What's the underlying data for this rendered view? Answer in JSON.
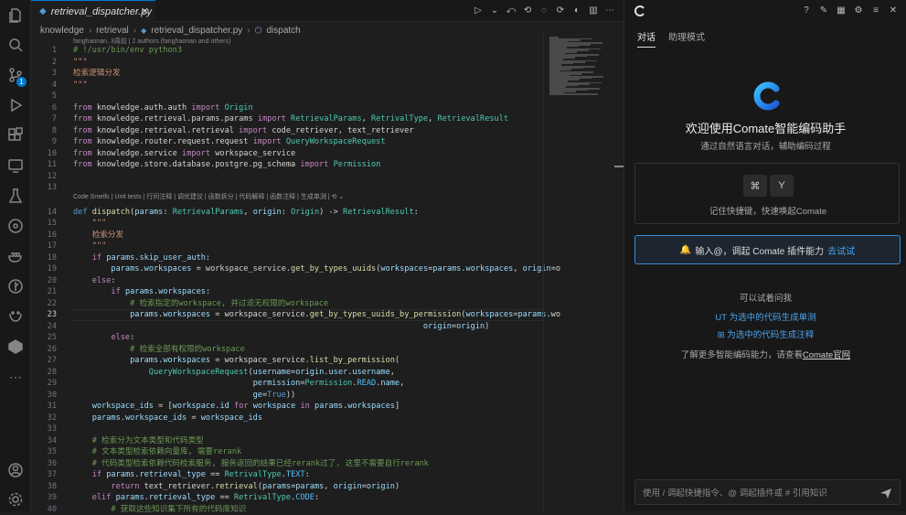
{
  "editor": {
    "tab_label": "retrieval_dispatcher.py",
    "breadcrumb": [
      "knowledge",
      "retrieval",
      "retrieval_dispatcher.py",
      "dispatch"
    ],
    "blame": "fanghaonan, 3周前 | 2 authors (fanghaonan and others)",
    "codelens": "Code Smells | Unit tests | 行间注释 | 调优建议 | 函数拆分 | 代码解释 | 函数注释 | 生成单测 |",
    "current_line": 23,
    "source_control_badge": "1"
  },
  "code_lines": [
    {
      "n": "1",
      "html": "<span class='c'># !/usr/bin/env python3</span>"
    },
    {
      "n": "2",
      "html": "<span class='s'>\"\"\"</span>"
    },
    {
      "n": "3",
      "html": "<span class='s'>检索逻辑分发</span>"
    },
    {
      "n": "4",
      "html": "<span class='s'>\"\"\"</span>"
    },
    {
      "n": "5",
      "html": ""
    },
    {
      "n": "6",
      "html": "<span class='k'>from</span> knowledge.auth.auth <span class='k'>import</span> <span class='t'>Origin</span>"
    },
    {
      "n": "7",
      "html": "<span class='k'>from</span> knowledge.retrieval.params.params <span class='k'>import</span> <span class='t'>RetrievalParams</span>, <span class='t'>RetrivalType</span>, <span class='t'>RetrievalResult</span>"
    },
    {
      "n": "8",
      "html": "<span class='k'>from</span> knowledge.retrieval.retrieval <span class='k'>import</span> code_retriever, text_retriever"
    },
    {
      "n": "9",
      "html": "<span class='k'>from</span> knowledge.router.request.request <span class='k'>import</span> <span class='t'>QueryWorkspaceRequest</span>"
    },
    {
      "n": "10",
      "html": "<span class='k'>from</span> knowledge.service <span class='k'>import</span> workspace_service"
    },
    {
      "n": "11",
      "html": "<span class='k'>from</span> knowledge.store.database.postgre.pg_schema <span class='k'>import</span> <span class='t'>Permission</span>"
    },
    {
      "n": "12",
      "html": ""
    },
    {
      "n": "13",
      "html": ""
    },
    {
      "n": "14",
      "html": "<span class='p'>def</span> <span class='f'>dispatch</span>(<span class='v'>params</span>: <span class='t'>RetrievalParams</span>, <span class='v'>origin</span>: <span class='t'>Origin</span>) -> <span class='t'>RetrievalResult</span>:"
    },
    {
      "n": "15",
      "html": "    <span class='s'>\"\"\"</span>"
    },
    {
      "n": "16",
      "html": "    <span class='s'>检索分发</span>"
    },
    {
      "n": "17",
      "html": "    <span class='s'>\"\"\"</span>"
    },
    {
      "n": "18",
      "html": "    <span class='k'>if</span> <span class='v'>params</span>.<span class='v'>skip_user_auth</span>:"
    },
    {
      "n": "19",
      "html": "        <span class='v'>params</span>.<span class='v'>workspaces</span> = workspace_service.<span class='f'>get_by_types_uuids</span>(<span class='v'>workspaces</span>=<span class='v'>params</span>.<span class='v'>workspaces</span>, <span class='v'>origin</span>=o"
    },
    {
      "n": "20",
      "html": "    <span class='k'>else</span>:"
    },
    {
      "n": "21",
      "html": "        <span class='k'>if</span> <span class='v'>params</span>.<span class='v'>workspaces</span>:"
    },
    {
      "n": "22",
      "html": "            <span class='c'># 检索指定的workspace, 并过滤无权限的workspace</span>"
    },
    {
      "n": "23",
      "html": "            <span class='v'>params</span>.<span class='v'>workspaces</span> = workspace_service.<span class='f'>get_by_types_uuids_by_permission</span>(<span class='v'>workspaces</span>=<span class='v'>params</span>.wo"
    },
    {
      "n": "24",
      "html": "                                                                          <span class='v'>origin</span>=<span class='v'>origin</span>)"
    },
    {
      "n": "25",
      "html": "        <span class='k'>else</span>:"
    },
    {
      "n": "26",
      "html": "            <span class='c'># 检索全部有权限的workspace</span>"
    },
    {
      "n": "27",
      "html": "            <span class='v'>params</span>.<span class='v'>workspaces</span> = workspace_service.<span class='f'>list_by_permission</span>("
    },
    {
      "n": "28",
      "html": "                <span class='t'>QueryWorkspaceRequest</span>(<span class='v'>username</span>=<span class='v'>origin</span>.<span class='v'>user</span>.<span class='v'>username</span>,"
    },
    {
      "n": "29",
      "html": "                                      <span class='v'>permission</span>=<span class='t'>Permission</span>.<span class='o'>READ</span>.<span class='v'>name</span>,"
    },
    {
      "n": "30",
      "html": "                                      <span class='v'>ge</span>=<span class='p'>True</span>))"
    },
    {
      "n": "31",
      "html": "    <span class='v'>workspace_ids</span> = [<span class='v'>workspace</span>.<span class='v'>id</span> <span class='k'>for</span> <span class='v'>workspace</span> <span class='k'>in</span> <span class='v'>params</span>.<span class='v'>workspaces</span>]"
    },
    {
      "n": "32",
      "html": "    <span class='v'>params</span>.<span class='v'>workspace_ids</span> = <span class='v'>workspace_ids</span>"
    },
    {
      "n": "33",
      "html": ""
    },
    {
      "n": "34",
      "html": "    <span class='c'># 检索分为文本类型和代码类型</span>"
    },
    {
      "n": "35",
      "html": "    <span class='c'># 文本类型检索依赖向量库, 需要rerank</span>"
    },
    {
      "n": "36",
      "html": "    <span class='c'># 代码类型检索依赖代码检索服务, 服务返回的结果已经rerank过了, 这里不需要自行rerank</span>"
    },
    {
      "n": "37",
      "html": "    <span class='k'>if</span> <span class='v'>params</span>.<span class='v'>retrieval_type</span> == <span class='t'>RetrivalType</span>.<span class='o'>TEXT</span>:"
    },
    {
      "n": "38",
      "html": "        <span class='k'>return</span> text_retriever.<span class='f'>retrieval</span>(<span class='v'>params</span>=<span class='v'>params</span>, <span class='v'>origin</span>=<span class='v'>origin</span>)"
    },
    {
      "n": "39",
      "html": "    <span class='k'>elif</span> <span class='v'>params</span>.<span class='v'>retrieval_type</span> == <span class='t'>RetrivalType</span>.<span class='o'>CODE</span>:"
    },
    {
      "n": "40",
      "html": "        <span class='c'># 获取这些知识集下所有的代码库知识</span>"
    }
  ],
  "chat": {
    "tabs": [
      "对话",
      "助理模式"
    ],
    "welcome": "欢迎使用Comate智能编码助手",
    "subtitle": "通过自然语言对话，辅助编码过程",
    "keys": [
      "⌘",
      "Y"
    ],
    "shortcut_text": "记住快捷键，快速唤起Comate",
    "plugin_tip_prefix": "输入@，调起 Comate 插件能力",
    "plugin_tip_link": "去试试",
    "try_title": "可以试着问我",
    "suggestion_1": "为选中的代码生成单测",
    "suggestion_2": "为选中的代码生成注释",
    "more_prefix": "了解更多智能编码能力，请查看",
    "more_link": "Comate官网",
    "input_placeholder": "使用 / 调起快捷指令、@ 调起插件或 # 引用知识"
  },
  "colors": {
    "accent": "#0078d4",
    "link": "#4aa3f0",
    "brand": "#1f8ef1"
  }
}
